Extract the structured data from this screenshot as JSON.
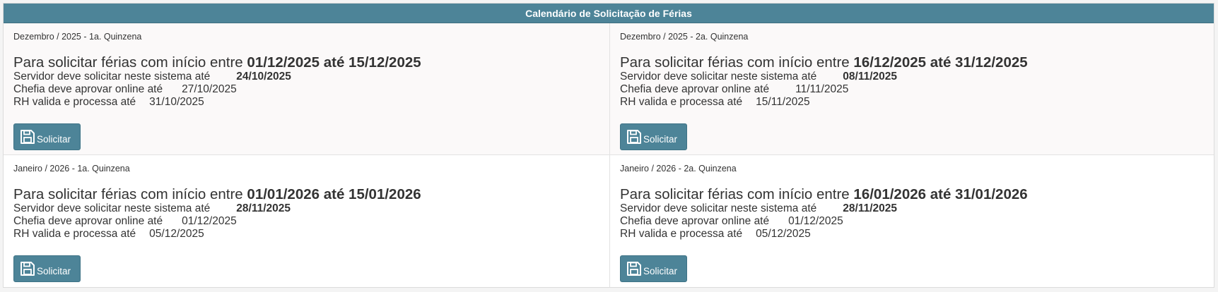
{
  "header": {
    "title": "Calendário de Solicitação de Férias"
  },
  "labels": {
    "headline_prefix": "Para solicitar férias com início entre",
    "servidor": "Servidor deve solicitar neste sistema até",
    "chefia": "Chefia deve aprovar online até",
    "rh": "RH valida e processa até",
    "button": "Solicitar"
  },
  "cards": [
    {
      "period": "Dezembro / 2025 - 1a. Quinzena",
      "range": "01/12/2025 até 15/12/2025",
      "servidor_date": "24/10/2025",
      "chefia_date": "27/10/2025",
      "rh_date": "31/10/2025"
    },
    {
      "period": "Dezembro / 2025 - 2a. Quinzena",
      "range": "16/12/2025 até 31/12/2025",
      "servidor_date": "08/11/2025",
      "chefia_date": "11/11/2025",
      "rh_date": "15/11/2025"
    },
    {
      "period": "Janeiro / 2026 - 1a. Quinzena",
      "range": "01/01/2026 até 15/01/2026",
      "servidor_date": "28/11/2025",
      "chefia_date": "01/12/2025",
      "rh_date": "05/12/2025"
    },
    {
      "period": "Janeiro / 2026 - 2a. Quinzena",
      "range": "16/01/2026 até 31/01/2026",
      "servidor_date": "28/11/2025",
      "chefia_date": "01/12/2025",
      "rh_date": "05/12/2025"
    }
  ],
  "icons": {
    "button_icon": "floppy-disk-icon"
  },
  "colors": {
    "accent": "#4d8498"
  }
}
